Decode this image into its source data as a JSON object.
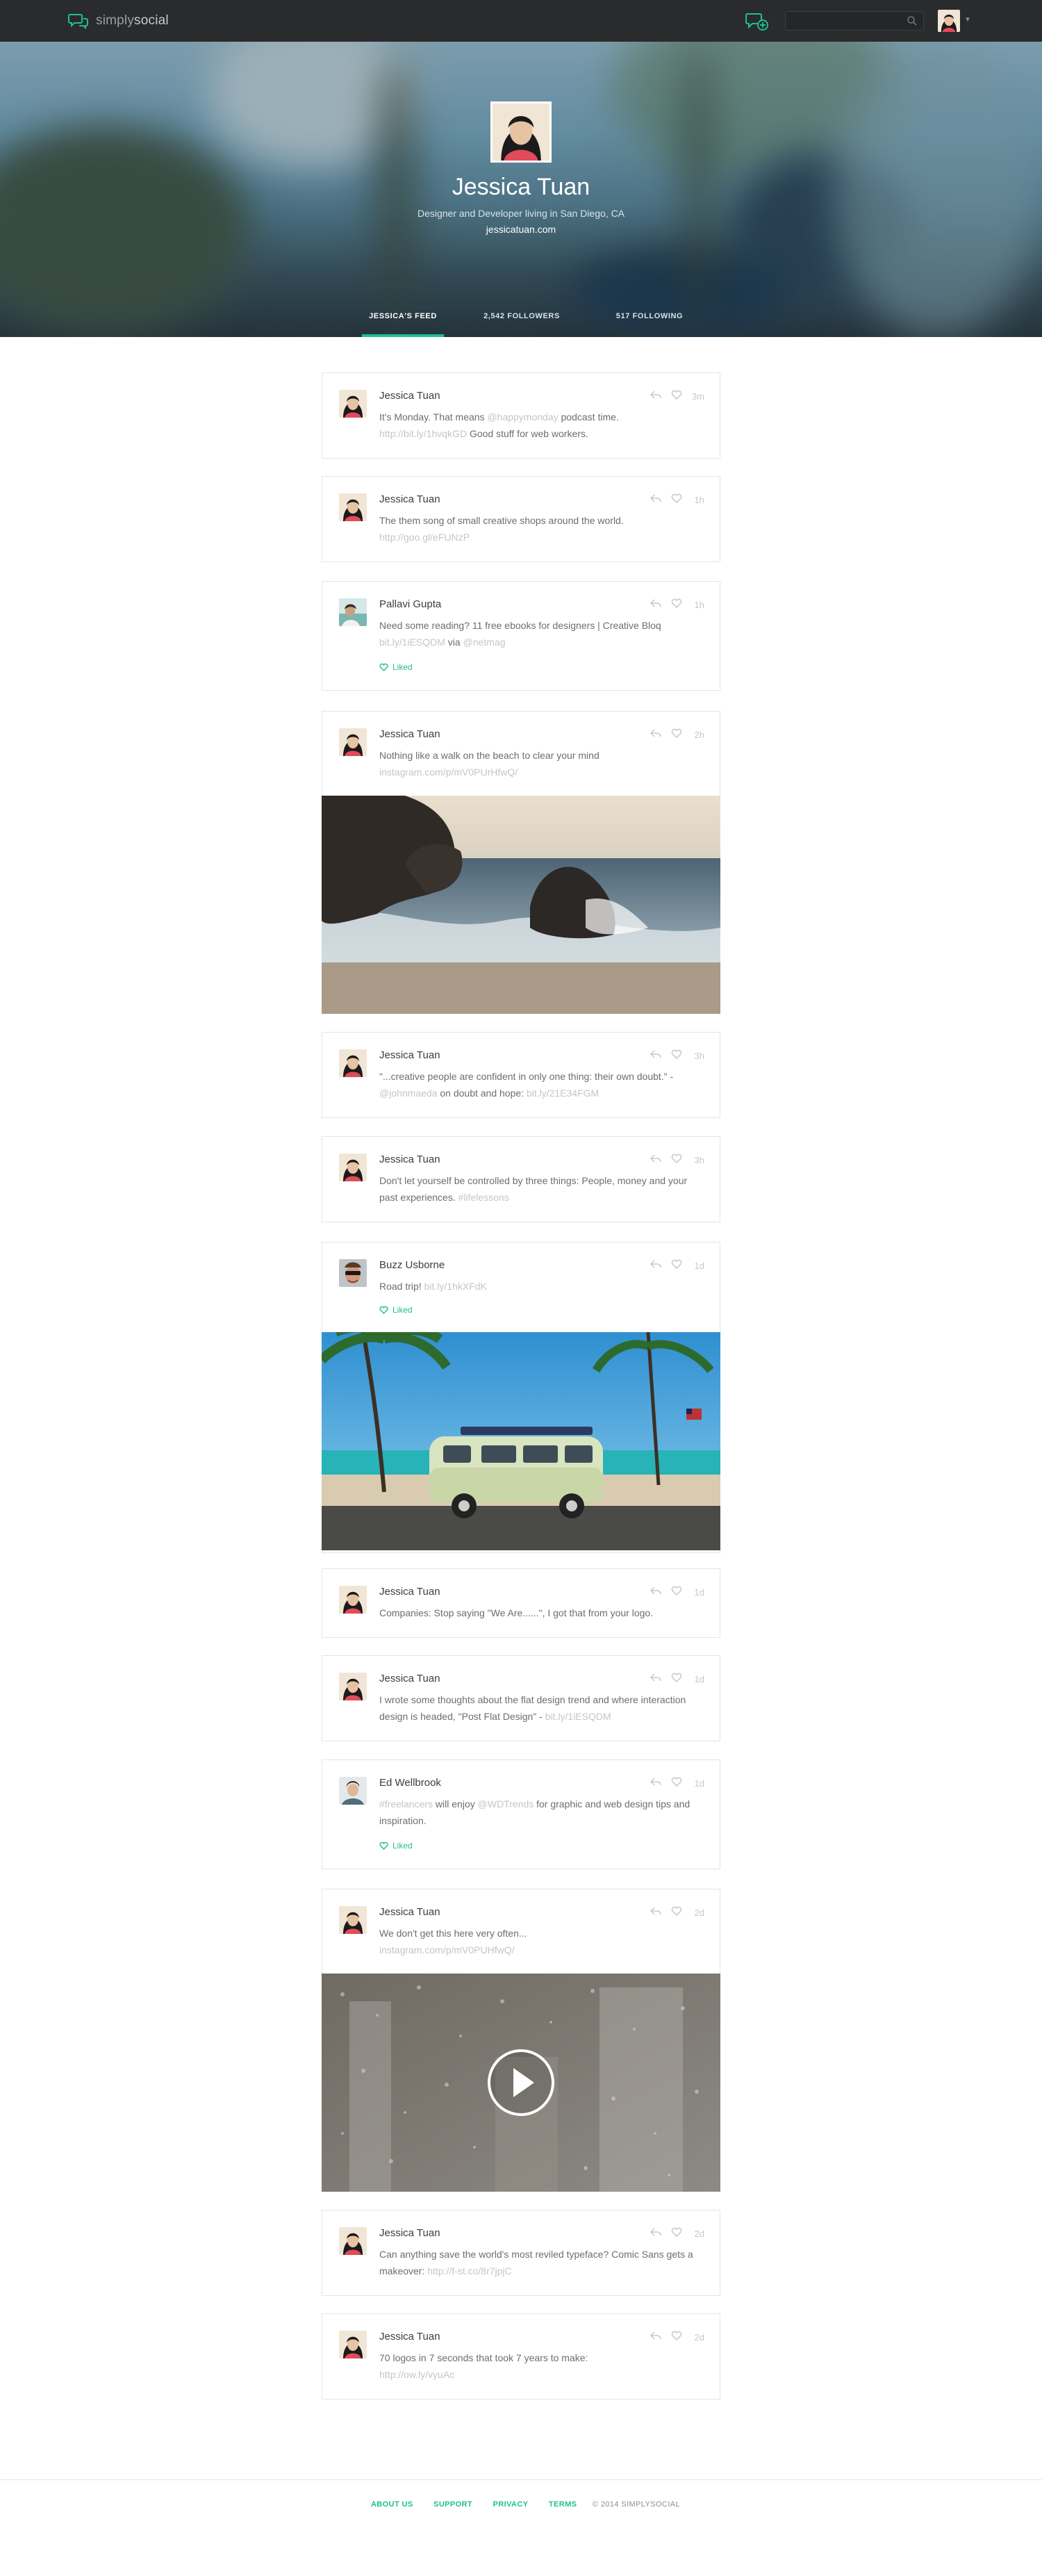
{
  "app": {
    "logo_light": "simply",
    "logo_bold": "social",
    "search_placeholder": ""
  },
  "colors": {
    "accent": "#1fbf8f",
    "topbar": "#2a2b2c"
  },
  "profile": {
    "name": "Jessica Tuan",
    "bio": "Designer and Developer living in San Diego, CA",
    "site": "jessicatuan.com"
  },
  "tabs": [
    {
      "label": "JESSICA'S FEED",
      "active": true
    },
    {
      "label": "2,542 FOLLOWERS",
      "active": false
    },
    {
      "label": "517 FOLLOWING",
      "active": false
    }
  ],
  "posts": [
    {
      "author": "Jessica Tuan",
      "time": "3m",
      "text_parts": [
        "It's Monday. That means ",
        "@happymonday",
        " podcast time.",
        "http://bit.ly/1hvqkGD",
        " Good stuff for web workers."
      ]
    },
    {
      "author": "Jessica Tuan",
      "time": "1h",
      "text_parts": [
        "The them song of small creative shops around the world.",
        "http://goo.gl/eFUNzP"
      ]
    },
    {
      "author": "Pallavi Gupta",
      "time": "1h",
      "text_parts": [
        "Need some reading? 11 free ebooks for designers | Creative Bloq",
        "bit.ly/1iESQDM",
        " via ",
        "@netmag"
      ],
      "liked": "Liked"
    },
    {
      "author": "Jessica Tuan",
      "time": "2h",
      "text_parts": [
        "Nothing like a walk on the beach to clear your mind",
        "instagram.com/p/mV0PUrHfwQ/"
      ],
      "media": "beach-rocks-photo"
    },
    {
      "author": "Jessica Tuan",
      "time": "3h",
      "text_parts": [
        "\"...creative people are confident in only one thing: their own doubt.\" - ",
        "@johnmaeda",
        " on doubt and hope: ",
        "bit.ly/21E34FGM"
      ]
    },
    {
      "author": "Jessica Tuan",
      "time": "3h",
      "text_parts": [
        "Don't let yourself be controlled by three things: People, money and your past experiences. ",
        "#lifelessons"
      ]
    },
    {
      "author": "Buzz Usborne",
      "time": "1d",
      "text_parts": [
        "Road trip! ",
        "bit.ly/1hkXFdK"
      ],
      "liked": "Liked",
      "media": "vw-van-beach-photo"
    },
    {
      "author": "Jessica Tuan",
      "time": "1d",
      "text_parts": [
        "Companies: Stop saying \"We Are......\", I got that from your logo."
      ]
    },
    {
      "author": "Jessica Tuan",
      "time": "1d",
      "text_parts": [
        "I wrote some thoughts about the flat design trend and where interaction design is headed, \"Post Flat Design\" - ",
        "bit.ly/1iESQDM"
      ]
    },
    {
      "author": "Ed Wellbrook",
      "time": "1d",
      "text_parts": [
        "#freelancers",
        " will enjoy ",
        "@WDTrends",
        " for graphic and web design tips and inspiration."
      ],
      "liked": "Liked"
    },
    {
      "author": "Jessica Tuan",
      "time": "2d",
      "text_parts": [
        "We don't get this here very often...",
        "instagram.com/p/mV0PUHfwQ/"
      ],
      "media": "rain-window-video"
    },
    {
      "author": "Jessica Tuan",
      "time": "2d",
      "text_parts": [
        "Can anything save the world's most reviled typeface? Comic Sans gets a makeover: ",
        "http://f-st.co/8r7jpjC"
      ]
    },
    {
      "author": "Jessica Tuan",
      "time": "2d",
      "text_parts": [
        "70 logos in 7 seconds that took 7 years to make:",
        "http://ow.ly/vyuAc"
      ]
    }
  ],
  "footer": {
    "links": [
      "ABOUT US",
      "SUPPORT",
      "PRIVACY",
      "TERMS"
    ],
    "copyright": "© 2014 SIMPLYSOCIAL"
  },
  "icons": [
    "chat-bubbles-icon",
    "new-message-icon",
    "search-icon",
    "reply-icon",
    "heart-icon",
    "play-icon"
  ]
}
